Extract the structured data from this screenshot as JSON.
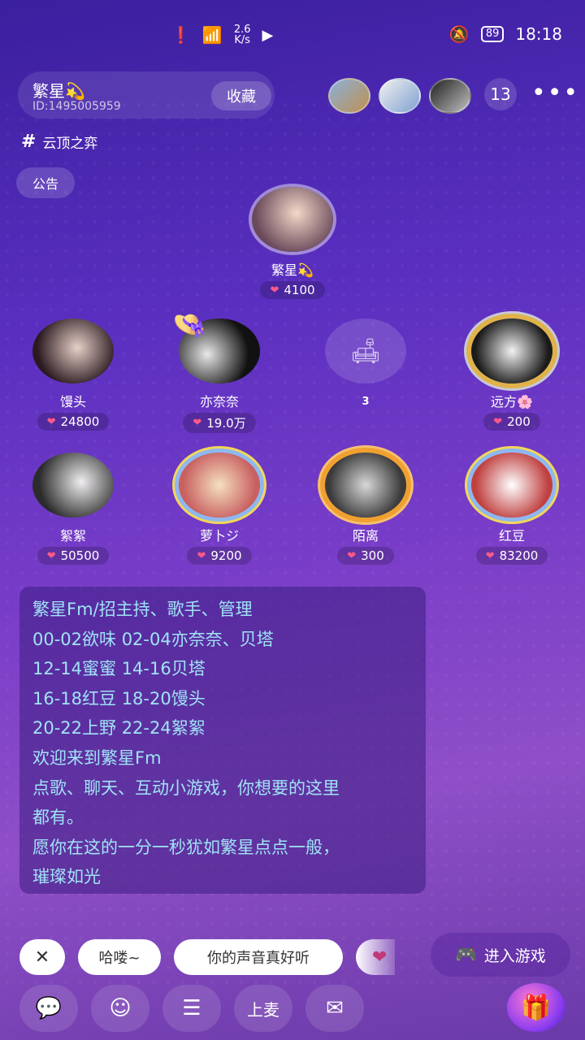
{
  "status_bar": {
    "net_speed": "2.6\nK/s",
    "battery": "89",
    "time": "18:18"
  },
  "room": {
    "name": "繁星💫",
    "id": "ID:1495005959",
    "favorite_label": "收藏",
    "audience_count": "13",
    "more": "•••",
    "tag": "云顶之弈",
    "notice_label": "公告"
  },
  "host": {
    "name": "繁星💫",
    "hearts": "4100"
  },
  "seats_row1": [
    {
      "name": "馒头",
      "hearts": "24800"
    },
    {
      "name": "亦奈奈",
      "hearts": "19.0万"
    },
    {
      "name": "3",
      "hearts": ""
    },
    {
      "name": "远方🌸",
      "hearts": "200"
    }
  ],
  "seats_row2": [
    {
      "name": "絮絮",
      "hearts": "50500"
    },
    {
      "name": "萝卜ジ",
      "hearts": "9200"
    },
    {
      "name": "陌离",
      "hearts": "300"
    },
    {
      "name": "红豆",
      "hearts": "83200"
    }
  ],
  "message_lines": [
    "繁星Fm/招主持、歌手、管理",
    "00-02欲味 02-04亦奈奈、贝塔",
    "12-14蜜蜜 14-16贝塔",
    "16-18红豆 18-20馒头",
    "20-22上野 22-24絮絮",
    "欢迎来到繁星Fm",
    "点歌、聊天、互动小游戏，你想要的这里",
    "都有。",
    "愿你在这的一分一秒犹如繁星点点一般，",
    "璀璨如光"
  ],
  "quick_replies": {
    "close": "✕",
    "r1": "哈喽~",
    "r2": "你的声音真好听"
  },
  "game_button": "进入游戏",
  "bottom_bar": {
    "mic_label": "上麦"
  },
  "colors": {
    "message_text": "#9fe3f5",
    "heart": "#ff5a8a"
  }
}
